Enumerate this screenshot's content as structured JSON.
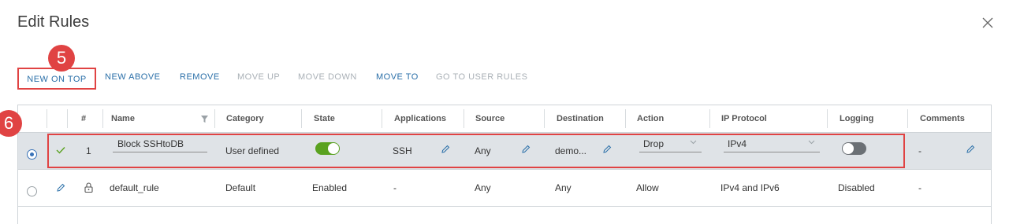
{
  "dialog": {
    "title": "Edit Rules"
  },
  "toolbar": {
    "new_on_top": "NEW ON TOP",
    "new_above": "NEW ABOVE",
    "remove": "REMOVE",
    "move_up": "MOVE UP",
    "move_down": "MOVE DOWN",
    "move_to": "MOVE TO",
    "go_to_user_rules": "GO TO USER RULES"
  },
  "annotations": {
    "step5": "5",
    "step6": "6"
  },
  "columns": {
    "num": "#",
    "name": "Name",
    "category": "Category",
    "state": "State",
    "applications": "Applications",
    "source": "Source",
    "destination": "Destination",
    "action": "Action",
    "ip_protocol": "IP Protocol",
    "logging": "Logging",
    "comments": "Comments"
  },
  "rows": [
    {
      "selected": true,
      "num": "1",
      "name": "Block SSHtoDB",
      "category": "User defined",
      "state_enabled": true,
      "applications": "SSH",
      "source": "Any",
      "destination": "demo...",
      "action": "Drop",
      "ip_protocol": "IPv4",
      "logging_enabled": false,
      "comments": "-"
    },
    {
      "selected": false,
      "name": "default_rule",
      "category": "Default",
      "state": "Enabled",
      "applications": "-",
      "source": "Any",
      "destination": "Any",
      "action": "Allow",
      "ip_protocol": "IPv4 and IPv6",
      "logging": "Disabled",
      "comments": "-"
    }
  ],
  "colors": {
    "accent": "#2a6fa8",
    "disabled": "#a9b0b6",
    "annotation_red": "#e04343",
    "toggle_on": "#5aa220",
    "toggle_off": "#6b7075",
    "selected_row": "#dfe3e7"
  },
  "icons": [
    "close-icon",
    "filter-icon",
    "check-icon",
    "pencil-icon",
    "lock-icon",
    "chevron-down-icon"
  ]
}
